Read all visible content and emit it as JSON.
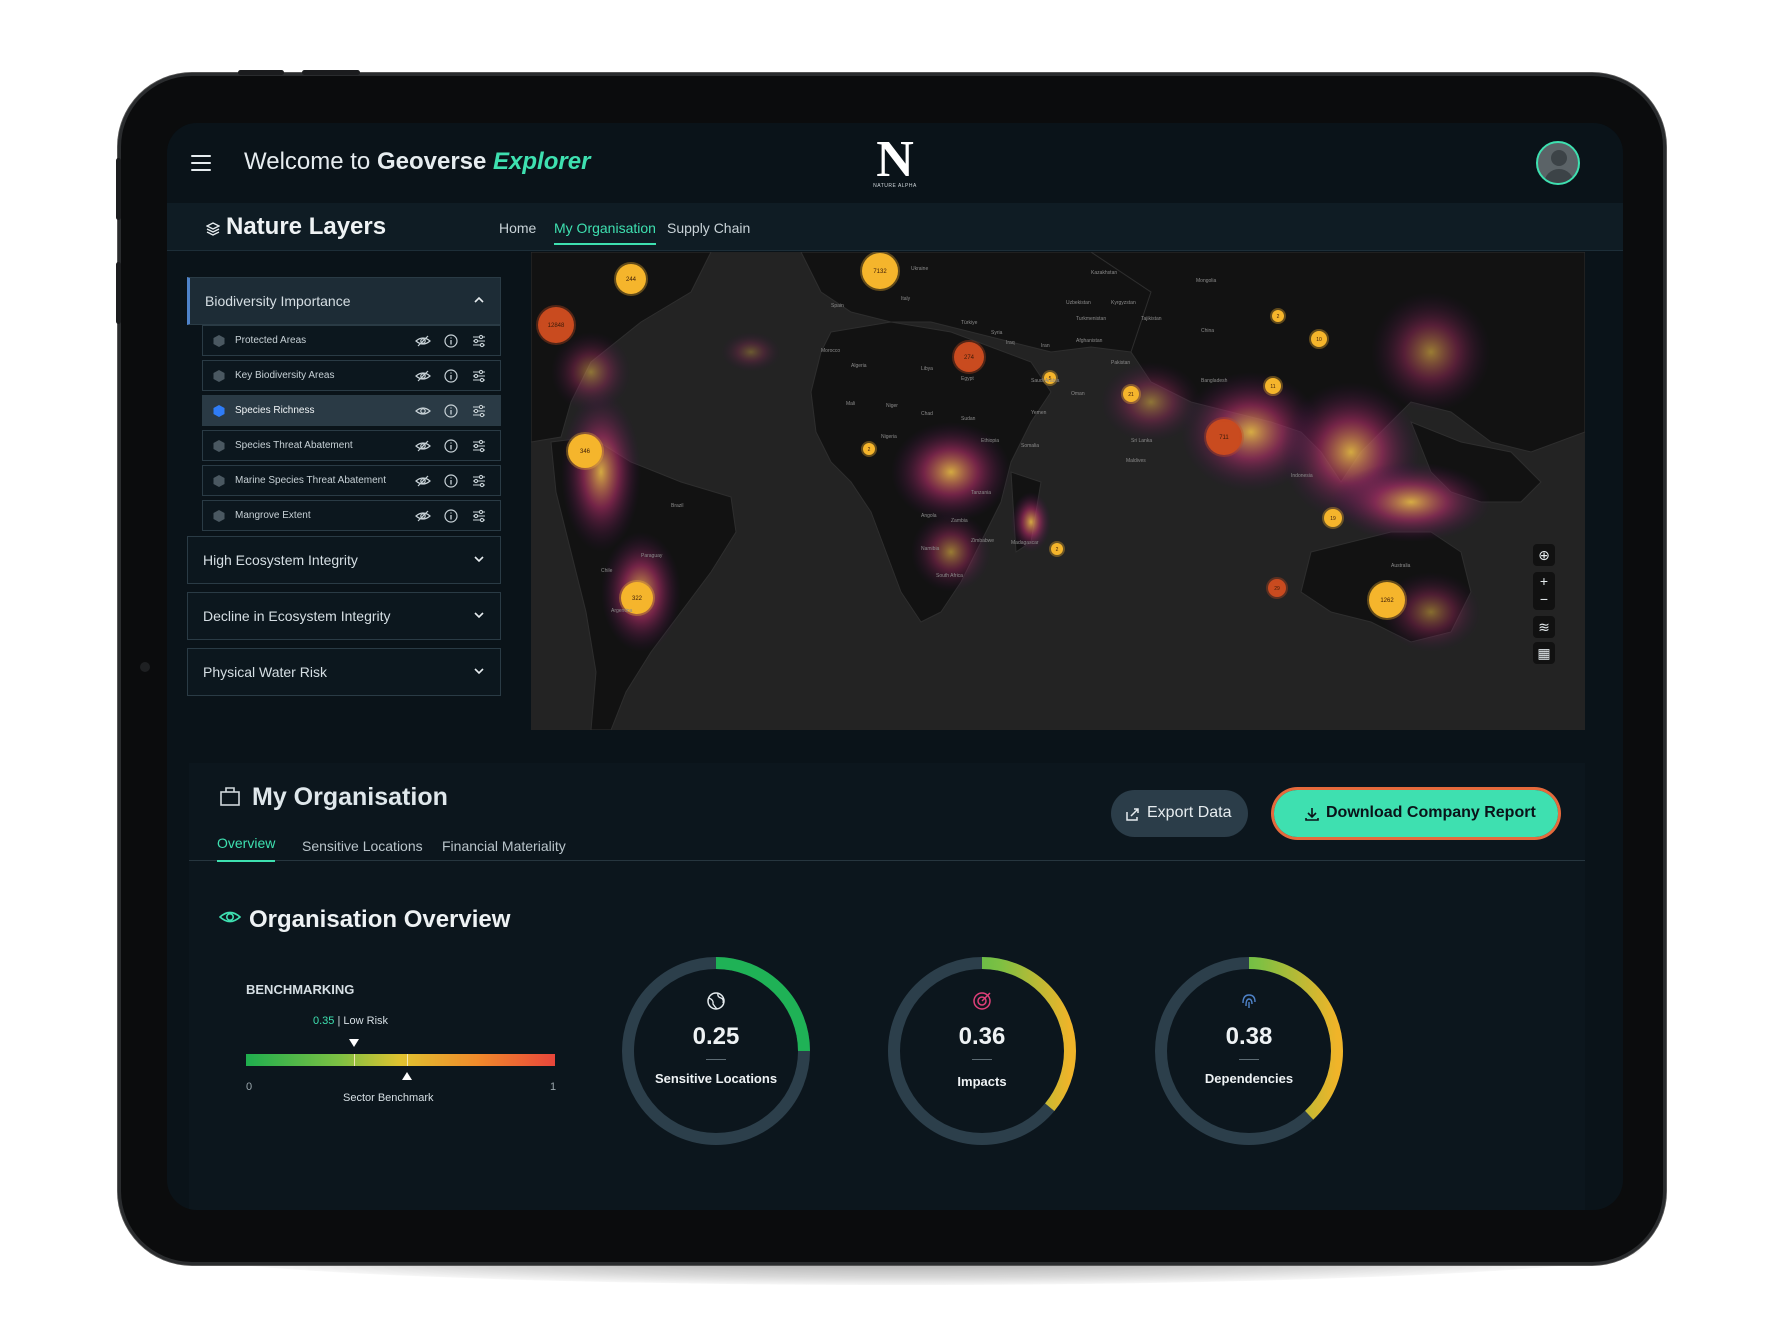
{
  "header": {
    "welcome_prefix": "Welcome to",
    "brand": "Geoverse",
    "product": "Explorer",
    "logo_mark": "N",
    "logo_text": "NATURE ALPHA"
  },
  "subheader": {
    "title": "Nature Layers",
    "tabs": [
      {
        "label": "Home",
        "active": false
      },
      {
        "label": "My Organisation",
        "active": true
      },
      {
        "label": "Supply Chain",
        "active": false
      }
    ]
  },
  "sidebar": {
    "sections": [
      {
        "label": "Biodiversity Importance",
        "open": true
      },
      {
        "label": "High Ecosystem Integrity",
        "open": false
      },
      {
        "label": "Decline in Ecosystem Integrity",
        "open": false
      },
      {
        "label": "Physical Water Risk",
        "open": false
      }
    ],
    "layers": [
      {
        "label": "Protected Areas",
        "active": false,
        "visible": false
      },
      {
        "label": "Key Biodiversity Areas",
        "active": false,
        "visible": false
      },
      {
        "label": "Species Richness",
        "active": true,
        "visible": true
      },
      {
        "label": "Species Threat Abatement",
        "active": false,
        "visible": false
      },
      {
        "label": "Marine Species Threat Abatement",
        "active": false,
        "visible": false
      },
      {
        "label": "Mangrove Extent",
        "active": false,
        "visible": false
      }
    ]
  },
  "map": {
    "clusters": [
      "244",
      "7132",
      "12848",
      "274",
      "346",
      "322",
      "711",
      "1262",
      "29",
      "19",
      "21",
      "11",
      "10",
      "2",
      "5",
      "2",
      "2"
    ],
    "country_labels": [
      "Ukraine",
      "Kazakhstan",
      "Mongolia",
      "Uzbekistan",
      "Kyrgyzstan",
      "Turkmenistan",
      "Tajikistan",
      "Afghanistan",
      "China",
      "Pakistan",
      "Türkiye",
      "Syria",
      "Iraq",
      "Iran",
      "Spain",
      "Italy",
      "Morocco",
      "Algeria",
      "Libya",
      "Egypt",
      "Saudi Arabia",
      "Oman",
      "Yemen",
      "Mali",
      "Niger",
      "Chad",
      "Sudan",
      "Nigeria",
      "Ethiopia",
      "Somalia",
      "Tanzania",
      "Angola",
      "Zambia",
      "Namibia",
      "Zimbabwe",
      "South Africa",
      "Madagascar",
      "Brazil",
      "Paraguay",
      "Chile",
      "Argentina",
      "Bangladesh",
      "Maldives",
      "Sri Lanka",
      "Indonesia",
      "Australia"
    ],
    "controls": [
      "locate-icon",
      "zoom-in-icon",
      "zoom-out-icon",
      "layers-icon",
      "map-icon"
    ]
  },
  "organisation": {
    "title": "My Organisation",
    "export_label": "Export Data",
    "download_label": "Download Company Report",
    "tabs": [
      {
        "label": "Overview",
        "active": true
      },
      {
        "label": "Sensitive Locations",
        "active": false
      },
      {
        "label": "Financial Materiality",
        "active": false
      }
    ],
    "overview_title": "Organisation Overview",
    "benchmarking": {
      "label": "BENCHMARKING",
      "value": "0.35",
      "risk_text": "| Low Risk",
      "min": "0",
      "max": "1",
      "sector_label": "Sector Benchmark",
      "value_fraction": 0.35,
      "sector_fraction": 0.52
    },
    "gauges": [
      {
        "value": "0.25",
        "label": "Sensitive Locations",
        "fraction": 0.25,
        "icon": "globe-icon",
        "icon_color": "#e6ecef"
      },
      {
        "value": "0.36",
        "label": "Impacts",
        "fraction": 0.36,
        "icon": "target-icon",
        "icon_color": "#e0407a"
      },
      {
        "value": "0.38",
        "label": "Dependencies",
        "fraction": 0.38,
        "icon": "fingerprint-icon",
        "icon_color": "#4f83c9"
      }
    ]
  },
  "colors": {
    "accent": "#3ee0b0",
    "screen_bg": "#0a1319",
    "download_border": "#e56a3c"
  }
}
